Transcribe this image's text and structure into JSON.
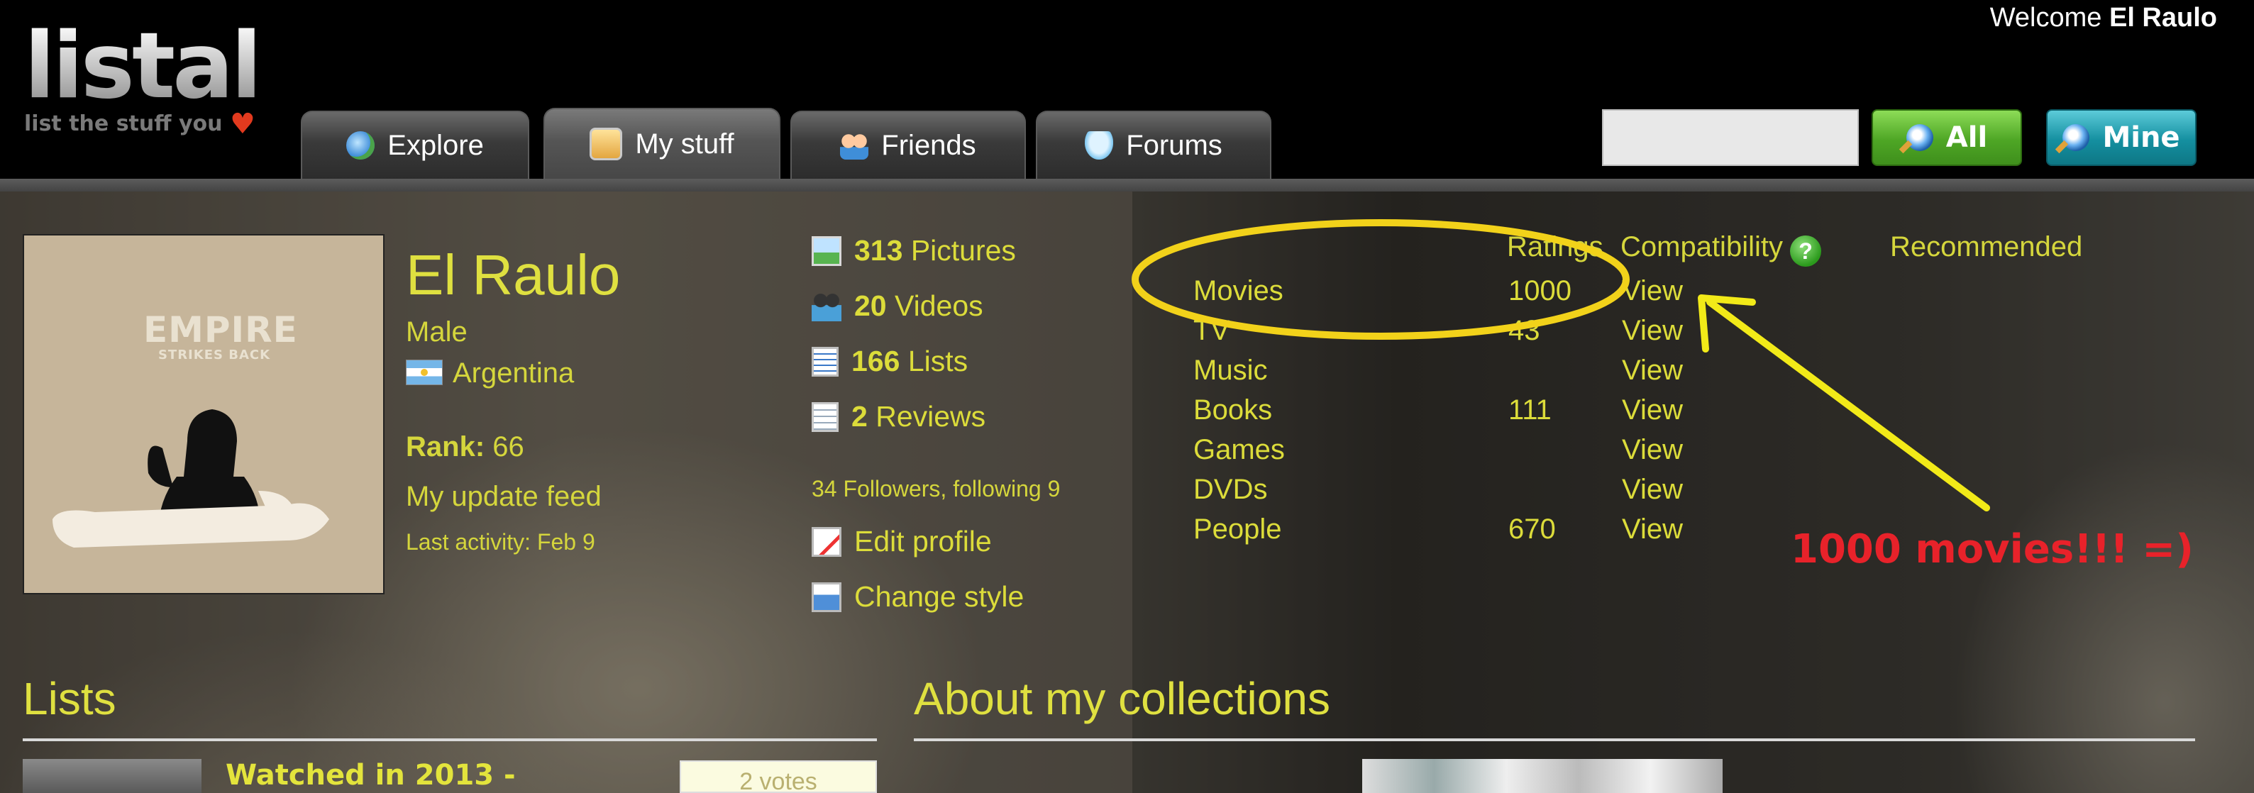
{
  "header": {
    "logo_text": "listal",
    "logo_tagline": "list the stuff you",
    "welcome_prefix": "Welcome",
    "welcome_user": "El Raulo",
    "tabs": [
      {
        "label": "Explore",
        "icon": "globe-icon"
      },
      {
        "label": "My stuff",
        "icon": "my-stuff-icon"
      },
      {
        "label": "Friends",
        "icon": "friends-icon"
      },
      {
        "label": "Forums",
        "icon": "forums-icon"
      }
    ],
    "active_tab": "My stuff",
    "search": {
      "value": "",
      "placeholder": ""
    },
    "search_buttons": {
      "all": "All",
      "mine": "Mine"
    }
  },
  "profile": {
    "name": "El Raulo",
    "avatar_poster": {
      "line1": "EMPIRE",
      "line2": "STRIKES BACK"
    },
    "gender": "Male",
    "country": "Argentina",
    "rank_label": "Rank:",
    "rank_value": "66",
    "update_feed": "My update feed",
    "last_activity": "Last activity: Feb 9"
  },
  "stats": {
    "pictures": {
      "count": "313",
      "label": "Pictures"
    },
    "videos": {
      "count": "20",
      "label": "Videos"
    },
    "lists": {
      "count": "166",
      "label": "Lists"
    },
    "reviews": {
      "count": "2",
      "label": "Reviews"
    },
    "followers": "34 Followers, following 9",
    "edit_profile": "Edit profile",
    "change_style": "Change style"
  },
  "ratings": {
    "headers": {
      "ratings": "Ratings",
      "compatibility": "Compatibility",
      "help": "?",
      "recommended": "Recommended"
    },
    "rows": [
      {
        "label": "Movies",
        "count": "1000",
        "view": "View"
      },
      {
        "label": "TV",
        "count": "43",
        "view": "View"
      },
      {
        "label": "Music",
        "count": "",
        "view": "View"
      },
      {
        "label": "Books",
        "count": "111",
        "view": "View"
      },
      {
        "label": "Games",
        "count": "",
        "view": "View"
      },
      {
        "label": "DVDs",
        "count": "",
        "view": "View"
      },
      {
        "label": "People",
        "count": "670",
        "view": "View"
      }
    ]
  },
  "annotation": {
    "text": "1000 movies!!! =)",
    "color": "#e8222a",
    "circle_color": "#f2d21a",
    "arrow_color": "#f2ea18"
  },
  "sections": {
    "lists_title": "Lists",
    "collections_title": "About my collections",
    "first_list_title": "Watched in 2013 -",
    "first_list_votes": "2 votes"
  },
  "colors": {
    "accent_text": "#dfe040",
    "header_bg": "#000000",
    "btn_all": "#4ea625",
    "btn_mine": "#148fa0"
  }
}
